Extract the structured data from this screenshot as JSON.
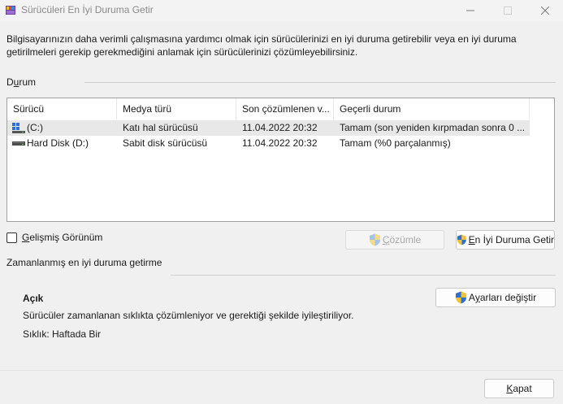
{
  "window": {
    "title": "Sürücüleri En İyi Duruma Getir"
  },
  "intro_text": "Bilgisayarınızın daha verimli çalışmasına yardımcı olmak için sürücülerinizi en iyi duruma getirebilir veya en iyi duruma getirilmeleri gerekip gerekmediğini anlamak için sürücülerinizi çözümleyebilirsiniz.",
  "status_group": {
    "label_prefix": "D",
    "label_underlined": "u",
    "label_suffix": "rum"
  },
  "table": {
    "columns": [
      "Sürücü",
      "Medya türü",
      "Son çözümlenen v...",
      "Geçerli durum"
    ],
    "rows": [
      {
        "drive": "(C:)",
        "icon": "windows-drive-icon",
        "media_type": "Katı hal sürücüsü",
        "last_analyzed": "11.04.2022 20:32",
        "status": "Tamam (son yeniden kırpmadan sonra 0 ...",
        "selected": true
      },
      {
        "drive": "Hard Disk (D:)",
        "icon": "hard-disk-icon",
        "media_type": "Sabit disk sürücüsü",
        "last_analyzed": "11.04.2022 20:32",
        "status": "Tamam (%0 parçalanmış)",
        "selected": false
      }
    ]
  },
  "advanced_view": {
    "prefix": "",
    "underlined": "G",
    "suffix": "elişmiş Görünüm",
    "checked": false
  },
  "buttons": {
    "analyze": {
      "underlined": "Ç",
      "suffix": "özümle",
      "enabled": false
    },
    "optimize": {
      "underlined": "E",
      "suffix": "n İyi Duruma Getir",
      "enabled": true
    },
    "change_settings": {
      "prefix": "A",
      "underlined": "y",
      "suffix": "arları değiştir"
    },
    "close": {
      "underlined": "K",
      "suffix": "apat"
    }
  },
  "scheduled": {
    "label": "Zamanlanmış en iyi duruma getirme",
    "status": "Açık",
    "description": "Sürücüler zamanlanan sıklıkta çözümleniyor ve gerektiği şekilde iyileştiriliyor.",
    "frequency": "Sıklık: Haftada Bir"
  },
  "colors": {
    "shield_blue": "#2f6fd0",
    "shield_yellow": "#f2c230",
    "selected_row": "#e8e8e8"
  }
}
